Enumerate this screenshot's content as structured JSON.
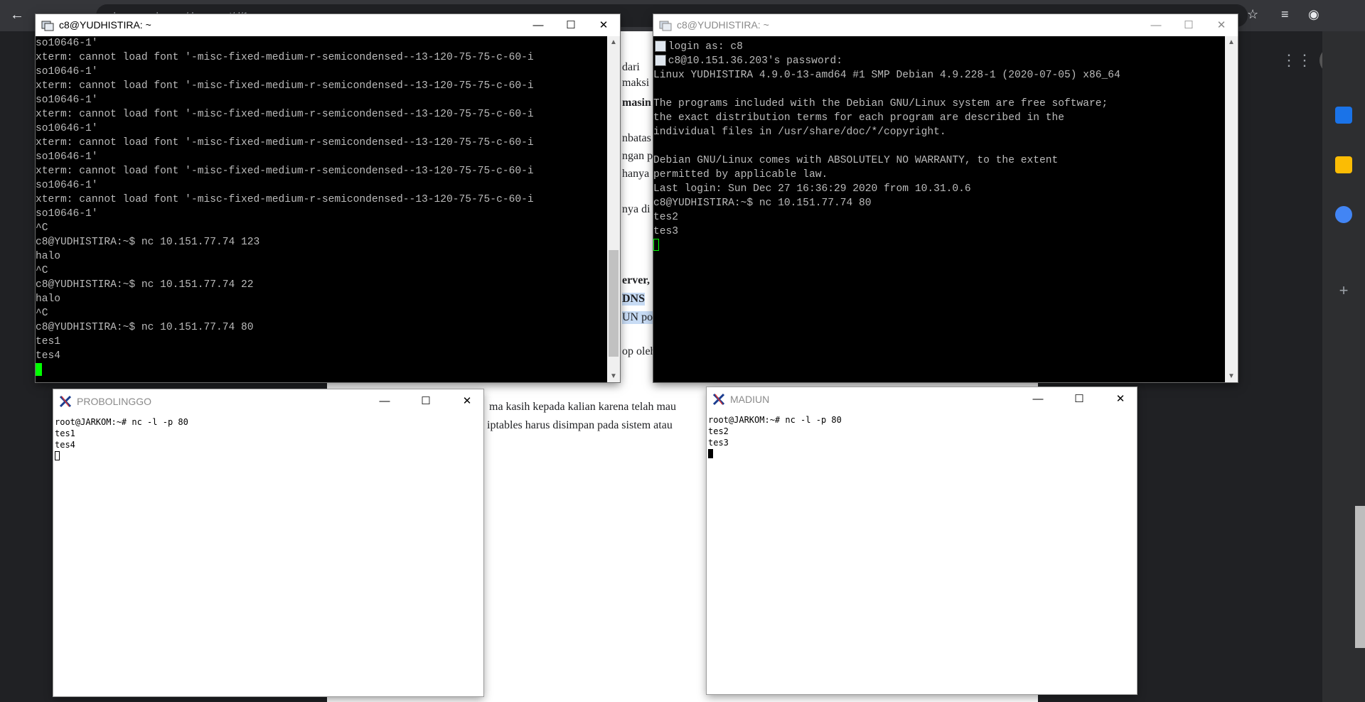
{
  "browser": {
    "back_icon": "arrow-left-icon",
    "url_partial": "docs.google.com/document/d/1...",
    "icons": [
      "star-icon",
      "media-icon",
      "profile-icon"
    ]
  },
  "doc_fragments": {
    "f1": "dari",
    "f2": "maksi",
    "f3": "masin",
    "f4": "nbatas",
    "f5": "ngan p",
    "f6": "hanya",
    "f7": "nya di",
    "f8": "erver,",
    "f9": "DNS",
    "f10": "UN po",
    "f11": "op oleh",
    "f12": "ma kasih kepada kalian karena telah mau",
    "f13": "iptables harus disimpan pada sistem atau"
  },
  "window1": {
    "title": "c8@YUDHISTIRA: ~",
    "lines": [
      "so10646-1'",
      "xterm: cannot load font '-misc-fixed-medium-r-semicondensed--13-120-75-75-c-60-i",
      "so10646-1'",
      "xterm: cannot load font '-misc-fixed-medium-r-semicondensed--13-120-75-75-c-60-i",
      "so10646-1'",
      "xterm: cannot load font '-misc-fixed-medium-r-semicondensed--13-120-75-75-c-60-i",
      "so10646-1'",
      "xterm: cannot load font '-misc-fixed-medium-r-semicondensed--13-120-75-75-c-60-i",
      "so10646-1'",
      "xterm: cannot load font '-misc-fixed-medium-r-semicondensed--13-120-75-75-c-60-i",
      "so10646-1'",
      "xterm: cannot load font '-misc-fixed-medium-r-semicondensed--13-120-75-75-c-60-i",
      "so10646-1'",
      "^C",
      "c8@YUDHISTIRA:~$ nc 10.151.77.74 123",
      "halo",
      "^C",
      "c8@YUDHISTIRA:~$ nc 10.151.77.74 22",
      "halo",
      "^C",
      "c8@YUDHISTIRA:~$ nc 10.151.77.74 80",
      "tes1",
      "tes4"
    ]
  },
  "window2": {
    "title": "c8@YUDHISTIRA: ~",
    "lines": [
      " login as: c8",
      " c8@10.151.36.203's password:",
      "Linux YUDHISTIRA 4.9.0-13-amd64 #1 SMP Debian 4.9.228-1 (2020-07-05) x86_64",
      "",
      "The programs included with the Debian GNU/Linux system are free software;",
      "the exact distribution terms for each program are described in the",
      "individual files in /usr/share/doc/*/copyright.",
      "",
      "Debian GNU/Linux comes with ABSOLUTELY NO WARRANTY, to the extent",
      "permitted by applicable law.",
      "Last login: Sun Dec 27 16:36:29 2020 from 10.31.0.6",
      "c8@YUDHISTIRA:~$ nc 10.151.77.74 80",
      "tes2",
      "tes3"
    ]
  },
  "probolinggo": {
    "title": "PROBOLINGGO",
    "lines": [
      "root@JARKOM:~# nc -l -p 80",
      "tes1",
      "tes4"
    ]
  },
  "madiun": {
    "title": "MADIUN",
    "lines": [
      "root@JARKOM:~# nc -l -p 80",
      "tes2",
      "tes3"
    ]
  },
  "controls": {
    "minimize": "—",
    "maximize": "☐",
    "close": "✕"
  }
}
